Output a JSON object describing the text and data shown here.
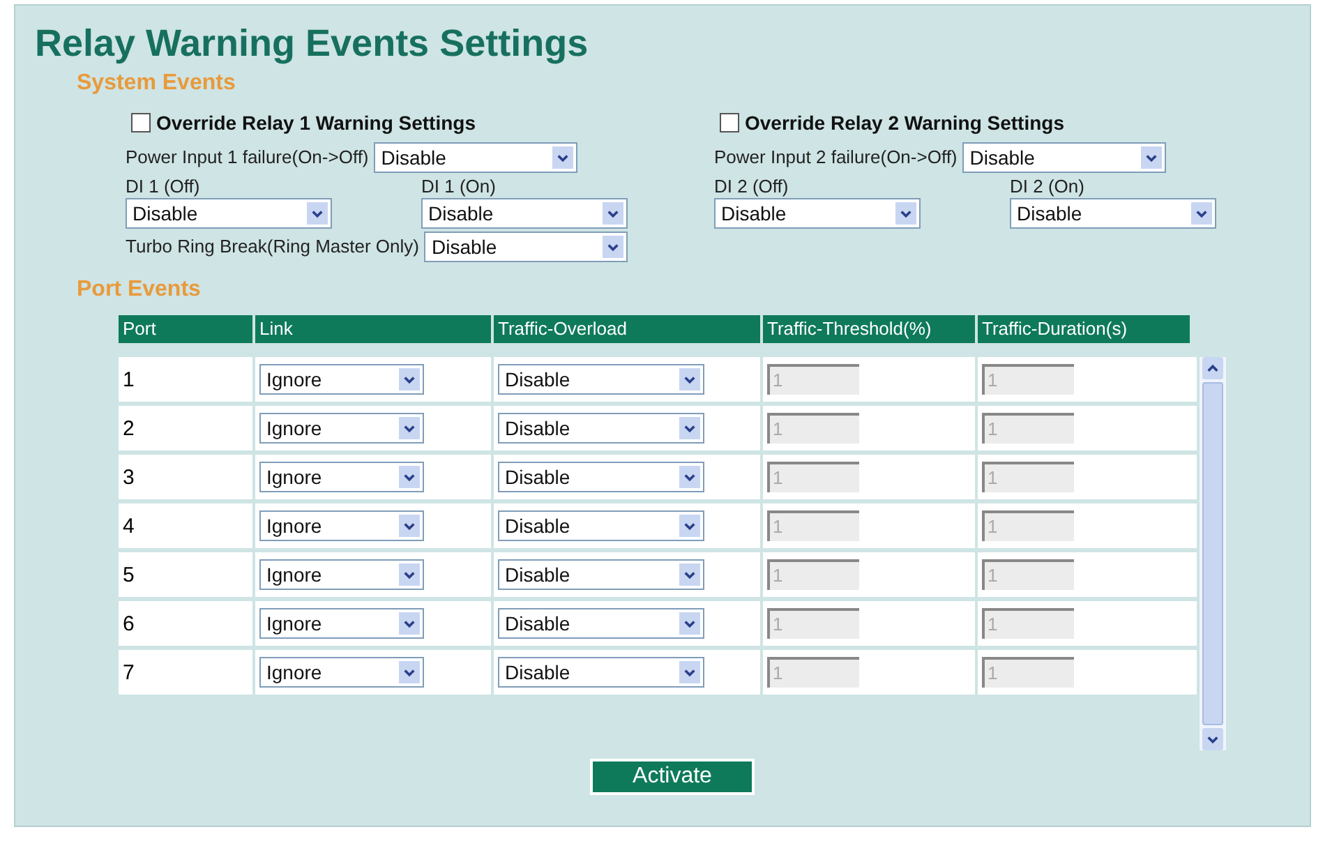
{
  "title": "Relay Warning Events Settings",
  "system_events": {
    "heading": "System Events",
    "relays": [
      {
        "override": {
          "label": "Override Relay 1 Warning Settings",
          "checked": false
        },
        "power": {
          "label": "Power Input 1 failure(On->Off)",
          "value": "Disable"
        },
        "di_off": {
          "label": "DI 1 (Off)",
          "value": "Disable"
        },
        "di_on": {
          "label": "DI 1 (On)",
          "value": "Disable"
        },
        "turbo": {
          "label": "Turbo Ring Break(Ring Master Only)",
          "value": "Disable"
        }
      },
      {
        "override": {
          "label": "Override Relay 2 Warning Settings",
          "checked": false
        },
        "power": {
          "label": "Power Input 2 failure(On->Off)",
          "value": "Disable"
        },
        "di_off": {
          "label": "DI 2 (Off)",
          "value": "Disable"
        },
        "di_on": {
          "label": "DI 2 (On)",
          "value": "Disable"
        }
      }
    ]
  },
  "port_events": {
    "heading": "Port Events",
    "columns": [
      "Port",
      "Link",
      "Traffic-Overload",
      "Traffic-Threshold(%)",
      "Traffic-Duration(s)"
    ],
    "rows": [
      {
        "port": "1",
        "link": "Ignore",
        "overload": "Disable",
        "threshold": {
          "value": "1",
          "disabled": true
        },
        "duration": {
          "value": "1",
          "disabled": true
        }
      },
      {
        "port": "2",
        "link": "Ignore",
        "overload": "Disable",
        "threshold": {
          "value": "1",
          "disabled": true
        },
        "duration": {
          "value": "1",
          "disabled": true
        }
      },
      {
        "port": "3",
        "link": "Ignore",
        "overload": "Disable",
        "threshold": {
          "value": "1",
          "disabled": true
        },
        "duration": {
          "value": "1",
          "disabled": true
        }
      },
      {
        "port": "4",
        "link": "Ignore",
        "overload": "Disable",
        "threshold": {
          "value": "1",
          "disabled": true
        },
        "duration": {
          "value": "1",
          "disabled": true
        }
      },
      {
        "port": "5",
        "link": "Ignore",
        "overload": "Disable",
        "threshold": {
          "value": "1",
          "disabled": true
        },
        "duration": {
          "value": "1",
          "disabled": true
        }
      },
      {
        "port": "6",
        "link": "Ignore",
        "overload": "Disable",
        "threshold": {
          "value": "1",
          "disabled": true
        },
        "duration": {
          "value": "1",
          "disabled": true
        }
      },
      {
        "port": "7",
        "link": "Ignore",
        "overload": "Disable",
        "threshold": {
          "value": "1",
          "disabled": true
        },
        "duration": {
          "value": "1",
          "disabled": true
        }
      }
    ]
  },
  "activate_button": "Activate"
}
